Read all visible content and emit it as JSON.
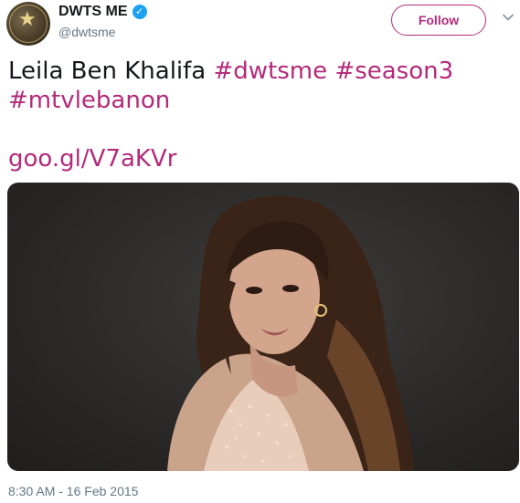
{
  "header": {
    "display_name": "DWTS ME",
    "handle": "@dwtsme",
    "avatar_icon": "dancing-stars-logo",
    "verified_icon": "verified-badge-icon",
    "follow_label": "Follow",
    "menu_icon": "chevron-down-icon"
  },
  "tweet": {
    "text": "Leila Ben Khalifa",
    "hashtags": [
      "#dwtsme",
      "#season3",
      "#mtvlebanon"
    ],
    "link": "goo.gl/V7aKVr",
    "timestamp": "8:30 AM - 16 Feb 2015"
  },
  "media": {
    "description_icon": "photo-portrait"
  },
  "colors": {
    "accent": "#b32a7b",
    "verified": "#1da1f2",
    "muted": "#657786",
    "text": "#14171a"
  }
}
